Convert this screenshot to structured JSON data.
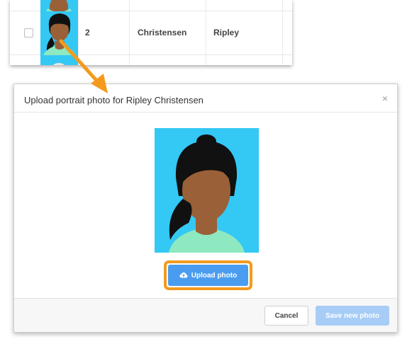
{
  "table": {
    "row": {
      "number": "2",
      "last_name": "Christensen",
      "first_name": "Ripley",
      "selected": false
    }
  },
  "modal": {
    "title": "Upload portrait photo for Ripley Christensen",
    "close_icon": "×",
    "upload_label": "Upload photo",
    "upload_icon": "cloud-upload-icon",
    "cancel_label": "Cancel",
    "save_label": "Save new photo"
  },
  "annotation": {
    "arrow_color": "#f39a1e",
    "highlight_color": "#f39a1e"
  },
  "colors": {
    "avatar_background": "#34c8f5",
    "primary_button": "#4a9cf0",
    "disabled_button": "#a7cdf6"
  }
}
